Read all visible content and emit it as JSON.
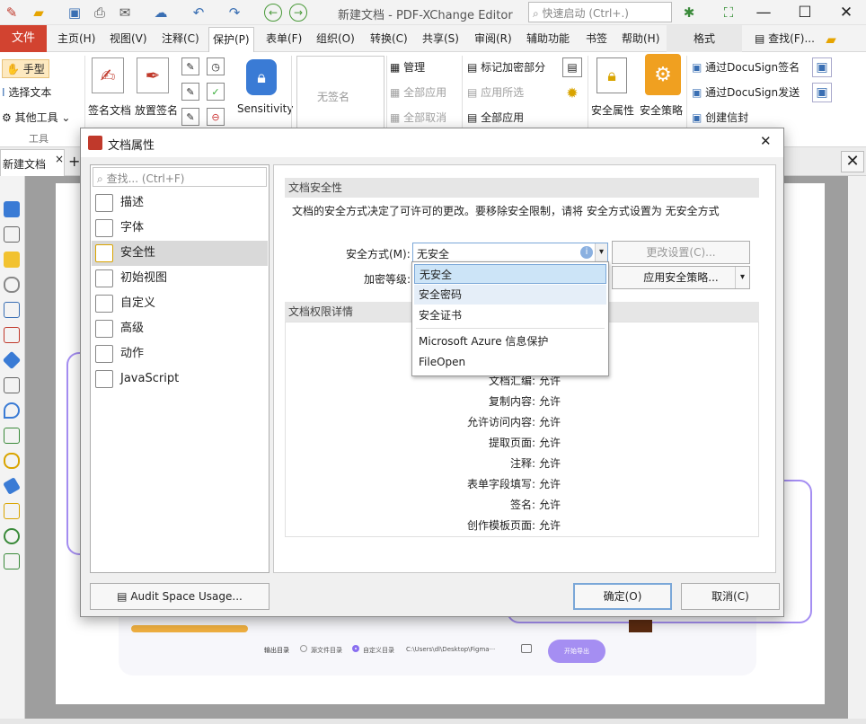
{
  "window": {
    "title": "新建文档 - PDF-XChange Editor",
    "quick_search_placeholder": "快速启动 (Ctrl+.)",
    "minimize": "—",
    "maximize": "☐",
    "close": "✕"
  },
  "menu": {
    "file": "文件",
    "tabs": [
      "主页(H)",
      "视图(V)",
      "注释(C)",
      "保护(P)",
      "表单(F)",
      "组织(O)",
      "转换(C)",
      "共享(S)",
      "审阅(R)",
      "辅助功能",
      "书签",
      "帮助(H)",
      "格式"
    ],
    "active_tab": "保护(P)",
    "find": "查找(F)..."
  },
  "ribbon": {
    "hand": "手型",
    "select_text": "选择文本",
    "other_tools": "其他工具",
    "tools_group": "工具",
    "sign_doc": "签名文档",
    "place_sig": "放置签名",
    "sensitivity": "Sensitivity",
    "no_signature": "无签名",
    "manage": "管理",
    "apply_all": "全部应用",
    "cancel_all": "全部取消",
    "mark_encrypt": "标记加密部分",
    "apply_selected": "应用所选",
    "apply_all2": "全部应用",
    "security_props": "安全属性",
    "security_policy": "安全策略",
    "docusign_sign": "通过DocuSign签名",
    "docusign_send": "通过DocuSign发送",
    "create_envelope": "创建信封"
  },
  "doc_tab": {
    "label": "新建文档",
    "close": "×",
    "add": "+"
  },
  "page_preview": {
    "output_dir": "输出目录",
    "source_dir": "源文件目录",
    "custom_dir": "自定义目录",
    "path": "C:\\Users\\dl\\Desktop\\Figma···",
    "start_export": "开始导出"
  },
  "dialog": {
    "title": "文档属性",
    "close": "✕",
    "search_placeholder": "查找... (Ctrl+F)",
    "nav_items": [
      {
        "label": "描述"
      },
      {
        "label": "字体"
      },
      {
        "label": "安全性"
      },
      {
        "label": "初始视图"
      },
      {
        "label": "自定义"
      },
      {
        "label": "高级"
      },
      {
        "label": "动作"
      },
      {
        "label": "JavaScript"
      }
    ],
    "selected_nav": "安全性",
    "security_section": "文档安全性",
    "security_desc": "文档的安全方式决定了可许可的更改。要移除安全限制，请将 安全方式设置为 无安全方式",
    "method_label": "安全方式(M):",
    "method_value": "无安全",
    "change_settings": "更改设置(C)...",
    "encrypt_label": "加密等级:",
    "apply_policy": "应用安全策略...",
    "permissions_section": "文档权限详情",
    "permissions": [
      {
        "label": "文档汇编:",
        "value": "允许"
      },
      {
        "label": "复制内容:",
        "value": "允许"
      },
      {
        "label": "允许访问内容:",
        "value": "允许"
      },
      {
        "label": "提取页面:",
        "value": "允许"
      },
      {
        "label": "注释:",
        "value": "允许"
      },
      {
        "label": "表单字段填写:",
        "value": "允许"
      },
      {
        "label": "签名:",
        "value": "允许"
      },
      {
        "label": "创作模板页面:",
        "value": "允许"
      }
    ],
    "audit": "Audit Space Usage...",
    "ok": "确定(O)",
    "cancel": "取消(C)"
  },
  "dropdown": {
    "options": [
      "无安全",
      "安全密码",
      "安全证书",
      "Microsoft Azure 信息保护",
      "FileOpen"
    ],
    "selected": "无安全",
    "hovered": "安全密码"
  },
  "colors": {
    "accent": "#d24330",
    "selection": "#cce4f7",
    "purple": "#a58ef2"
  }
}
